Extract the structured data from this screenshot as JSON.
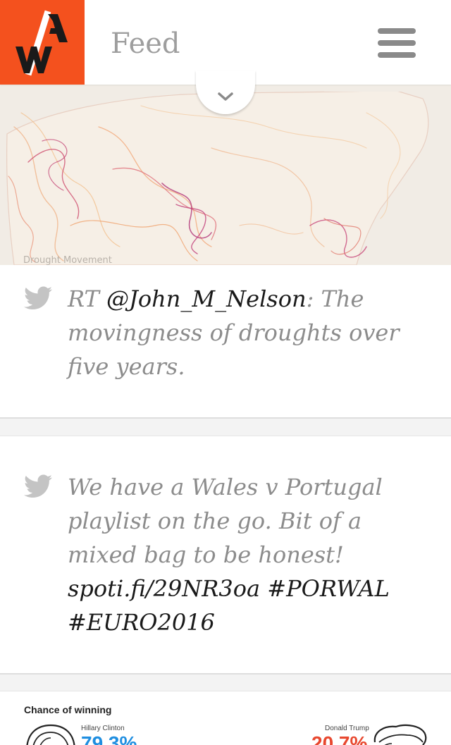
{
  "header": {
    "title": "Feed",
    "logo_label": "AV",
    "brand_color": "#f4511e"
  },
  "map": {
    "caption": "Drought Movement"
  },
  "tweets": [
    {
      "prefix": "RT ",
      "handle": "@John_M_Nelson",
      "text": ": The movingness of droughts over five years."
    },
    {
      "text": "We have a Wales v Portugal playlist on the go. Bit of a mixed bag to be honest! ",
      "link": "spoti.fi/29NR3oa",
      "hashtag1": "#PORWAL",
      "hashtag2": "#EURO2016"
    }
  ],
  "chart_data": {
    "type": "bar",
    "title": "Chance of winning",
    "categories": [
      "Hillary Clinton",
      "Donald Trump"
    ],
    "values": [
      79.3,
      20.7
    ],
    "display": [
      "79.3%",
      "20.7%"
    ],
    "colors": [
      "#1f8ee0",
      "#e8482f"
    ]
  }
}
